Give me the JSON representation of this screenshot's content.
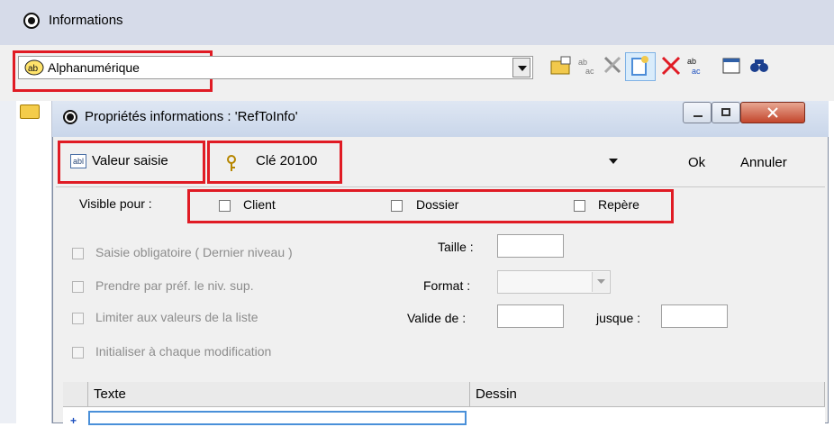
{
  "app": {
    "title": "Informations"
  },
  "toolbar": {
    "type_label": "Alphanumérique",
    "icons": [
      "new-folder-icon",
      "spellcheck-icon",
      "settings-tools-icon",
      "new-item-icon",
      "delete-icon",
      "replace-icon",
      "properties-icon",
      "find-icon"
    ]
  },
  "dialog": {
    "title": "Propriétés informations : 'RefToInfo'",
    "value_button": "Valeur saisie",
    "key_label": "Clé 20100",
    "ok": "Ok",
    "cancel": "Annuler",
    "visible_for": "Visible pour :",
    "visibility": [
      "Client",
      "Dossier",
      "Repère"
    ],
    "options": [
      "Saisie obligatoire ( Dernier niveau )",
      "Prendre par préf. le niv. sup.",
      "Limiter aux valeurs de la liste",
      "Initialiser à chaque modification"
    ],
    "size_label": "Taille :",
    "format_label": "Format :",
    "valid_from_label": "Valide de :",
    "until_label": "jusque :",
    "grid_columns": [
      "Texte",
      "Dessin"
    ]
  },
  "colors": {
    "highlight": "#e01b24",
    "dialog_bg": "#f0f0f0"
  }
}
